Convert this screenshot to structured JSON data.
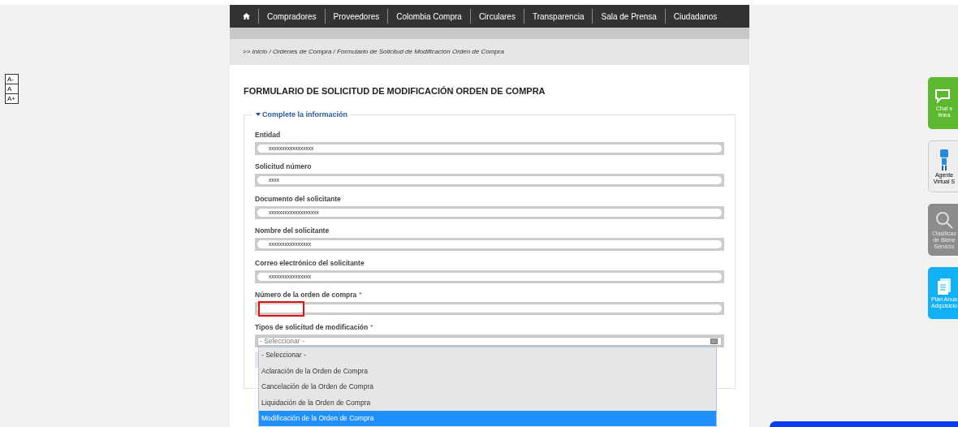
{
  "font_controls": [
    "A-",
    "A",
    "A+"
  ],
  "nav": {
    "items": [
      {
        "kind": "home"
      },
      {
        "kind": "link",
        "label": "Compradores"
      },
      {
        "kind": "link",
        "label": "Proveedores"
      },
      {
        "kind": "link",
        "label": "Colombia Compra"
      },
      {
        "kind": "link",
        "label": "Circulares"
      },
      {
        "kind": "link",
        "label": "Transparencia"
      },
      {
        "kind": "link",
        "label": "Sala de Prensa"
      },
      {
        "kind": "link",
        "label": "Ciudadanos"
      }
    ]
  },
  "breadcrumb": ">> Inicio / Ordenes de Compra / Formulario de Solicitud de Modificación Orden de Compra",
  "form": {
    "title": "FORMULARIO DE SOLICITUD DE MODIFICACIÓN ORDEN DE COMPRA",
    "legend": "Complete la información",
    "fields": [
      {
        "label": "Entidad",
        "value": "xxxxxxxxxxxxxxxxx",
        "invalid": false
      },
      {
        "label": "Solicitud número",
        "value": "xxxx",
        "invalid": false
      },
      {
        "label": "Documento del solicitante",
        "value": "xxxxxxxxxxxxxxxxxxx",
        "invalid": false
      },
      {
        "label": "Nombre del solicitante",
        "value": "xxxxxxxxxxxxxxxx",
        "invalid": false
      },
      {
        "label": "Correo electrónico del solicitante",
        "value": "xxxxxxxxxxxxxxxx",
        "invalid": false
      },
      {
        "label": "Número de la orden de compra",
        "required_mark": "*",
        "invalid": true
      }
    ],
    "select": {
      "label": "Tipos de solicitud de modificación",
      "required_mark": "*",
      "placeholder": "- Seleccionar -",
      "options": [
        {
          "label": "- Seleccionar -",
          "selected": false
        },
        {
          "label": "Aclaración de la Orden de Compra",
          "selected": false
        },
        {
          "label": "Cancelación de la Orden de Compra",
          "selected": false
        },
        {
          "label": "Liquidación de la Orden de Compra",
          "selected": false
        },
        {
          "label": "Modificación de la Orden de Compra",
          "selected": true
        }
      ]
    }
  },
  "side_widgets": [
    {
      "kind": "chat",
      "lines": [
        "Chat e",
        "línea"
      ]
    },
    {
      "kind": "agent",
      "lines": [
        "Agente",
        "Virtual S"
      ]
    },
    {
      "kind": "search",
      "lines": [
        "Clasificac",
        "de Biene",
        "Servicio"
      ]
    },
    {
      "kind": "plan",
      "lines": [
        "Plan Anua",
        "Adquisicio"
      ]
    }
  ]
}
